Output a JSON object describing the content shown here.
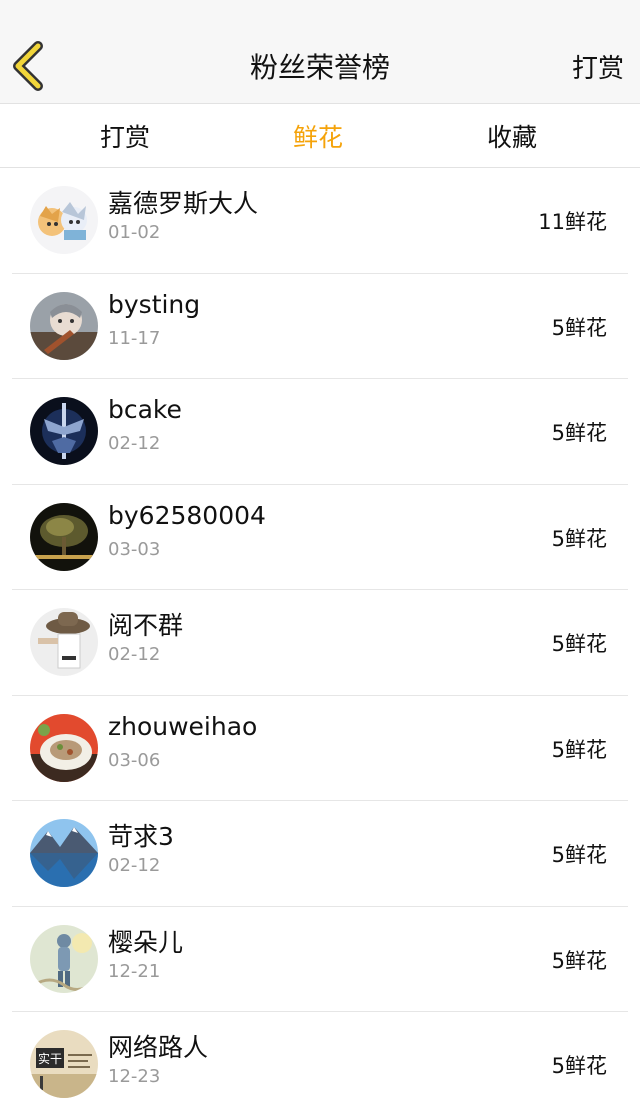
{
  "header": {
    "title": "粉丝荣誉榜",
    "right_action": "打赏"
  },
  "tabs": [
    {
      "label": "打赏",
      "active": false
    },
    {
      "label": "鲜花",
      "active": true
    },
    {
      "label": "收藏",
      "active": false
    }
  ],
  "colors": {
    "accent": "#f5a30a",
    "back_icon": "#f2d63a"
  },
  "fans": [
    {
      "name": "嘉德罗斯大人",
      "date": "01-02",
      "count": "11鲜花",
      "avatar": "anime-avatar"
    },
    {
      "name": "bysting",
      "date": "11-17",
      "count": "5鲜花",
      "avatar": "violin-avatar"
    },
    {
      "name": "bcake",
      "date": "02-12",
      "count": "5鲜花",
      "avatar": "sword-avatar"
    },
    {
      "name": "by62580004",
      "date": "03-03",
      "count": "5鲜花",
      "avatar": "tree-avatar"
    },
    {
      "name": "阅不群",
      "date": "02-12",
      "count": "5鲜花",
      "avatar": "hat-avatar"
    },
    {
      "name": "zhouweihao",
      "date": "03-06",
      "count": "5鲜花",
      "avatar": "food-avatar"
    },
    {
      "name": "苛求3",
      "date": "02-12",
      "count": "5鲜花",
      "avatar": "lake-avatar"
    },
    {
      "name": "樱朵儿",
      "date": "12-21",
      "count": "5鲜花",
      "avatar": "figure-avatar"
    },
    {
      "name": "网络路人",
      "date": "12-23",
      "count": "5鲜花",
      "avatar": "text-avatar",
      "avatar_text": "实干"
    }
  ]
}
